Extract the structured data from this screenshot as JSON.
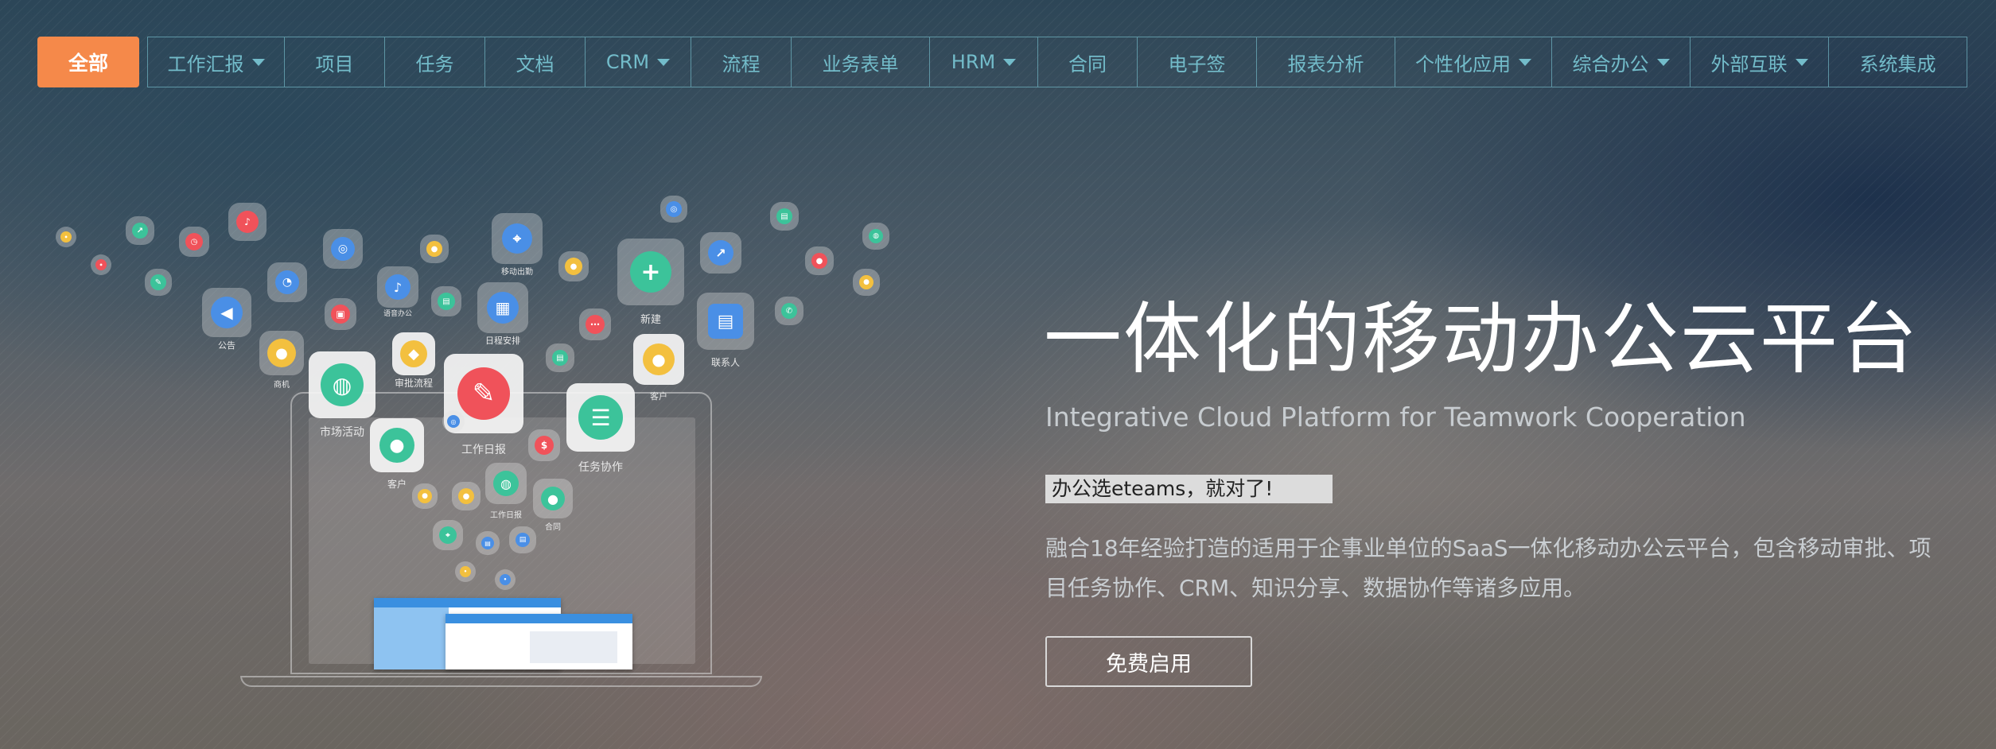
{
  "nav": {
    "active": "全部",
    "items": [
      {
        "label": "工作汇报",
        "dropdown": true
      },
      {
        "label": "项目",
        "dropdown": false
      },
      {
        "label": "任务",
        "dropdown": false
      },
      {
        "label": "文档",
        "dropdown": false
      },
      {
        "label": "CRM",
        "dropdown": true
      },
      {
        "label": "流程",
        "dropdown": false
      },
      {
        "label": "业务表单",
        "dropdown": false
      },
      {
        "label": "HRM",
        "dropdown": true
      },
      {
        "label": "合同",
        "dropdown": false
      },
      {
        "label": "电子签",
        "dropdown": false
      },
      {
        "label": "报表分析",
        "dropdown": false
      },
      {
        "label": "个性化应用",
        "dropdown": true
      },
      {
        "label": "综合办公",
        "dropdown": true
      },
      {
        "label": "外部互联",
        "dropdown": true
      },
      {
        "label": "系统集成",
        "dropdown": false
      }
    ]
  },
  "hero": {
    "title": "一体化的移动办公云平台",
    "subtitle": "Integrative Cloud Platform for Teamwork Cooperation",
    "badge": "办公选eteams，就对了!",
    "description": "融合18年经验打造的适用于企事业单位的SaaS一体化移动办公云平台，包含移动审批、项目任务协作、CRM、知识分享、数据协作等诸多应用。",
    "cta": "免费启用"
  },
  "illustration": {
    "labels": {
      "market": "市场活动",
      "daily_report": "工作日报",
      "task_collab": "任务协作",
      "customer_large": "客户",
      "approval_flow": "审批流程",
      "schedule": "日程安排",
      "new": "新建",
      "contacts": "联系人",
      "customer_small": "客户",
      "announcement": "公告",
      "phone": "商机",
      "work_log": "工作日报",
      "contract": "合同",
      "mobile_out": "移动出勤",
      "voice_office": "语音办公"
    },
    "colors": {
      "green": "#3cc39a",
      "red": "#f0525a",
      "yellow": "#f3c03f",
      "blue": "#4a8fe6"
    }
  },
  "colors": {
    "accent": "#f5894a",
    "nav_text": "#73bcca"
  }
}
